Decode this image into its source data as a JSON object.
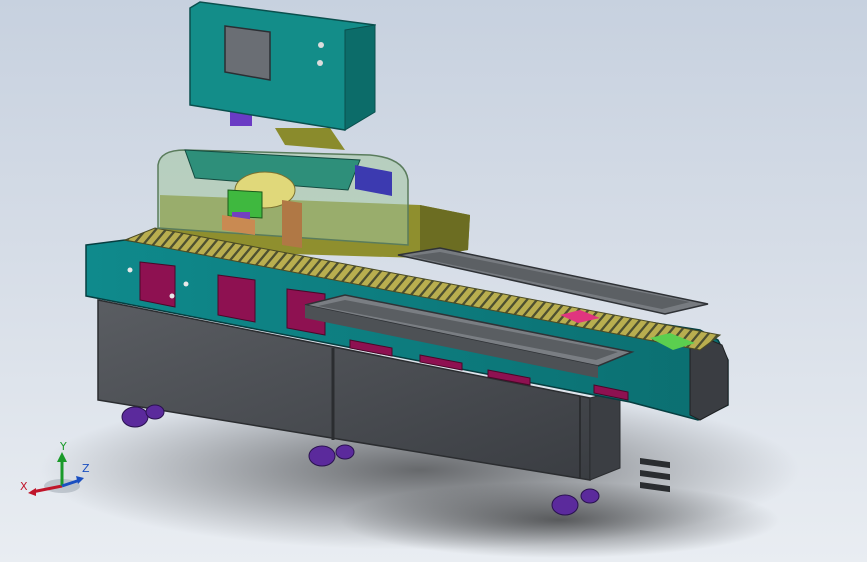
{
  "axes": {
    "x_label": "X",
    "y_label": "Y",
    "z_label": "Z"
  },
  "colors": {
    "background_top": "#c7d1df",
    "background_bottom": "#e9edf2",
    "teal_frame": "#0f8486",
    "teal_dark": "#0a5f61",
    "magenta_panel": "#8e1151",
    "cabinet_dark": "#4a4d52",
    "olive_chain": "#b5ad55",
    "tray_grey": "#6b6f74",
    "wheel_purple": "#5b2a9c",
    "axis_x": "#c0152a",
    "axis_y": "#1a9a2a",
    "axis_z": "#1a4fc0"
  }
}
